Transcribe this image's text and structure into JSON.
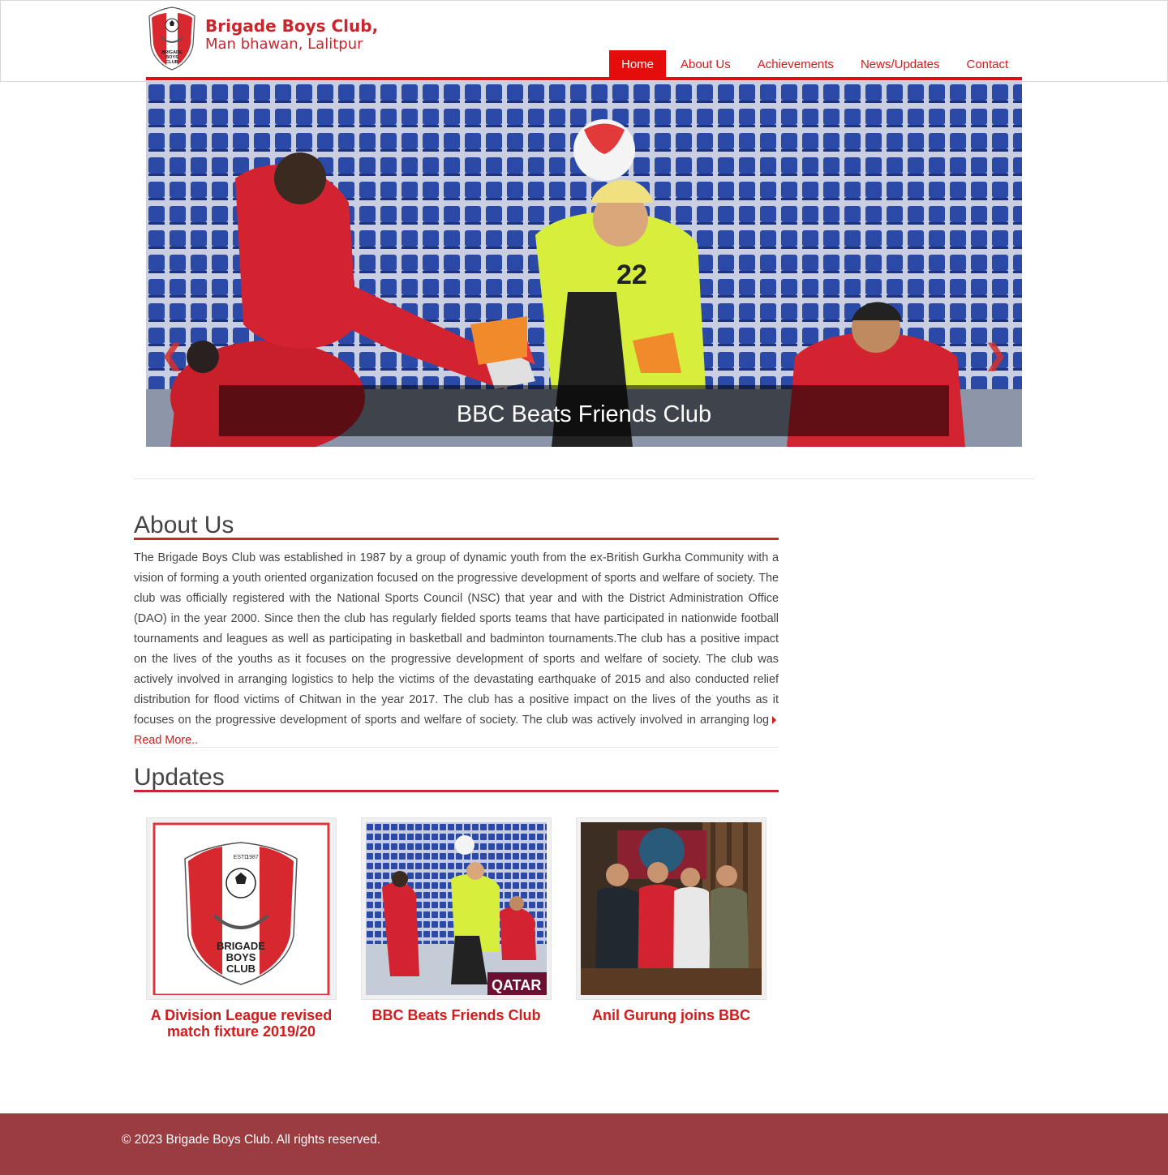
{
  "header": {
    "logo_line1": "Brigade Boys Club,",
    "logo_line2": "Man bhawan, Lalitpur",
    "nav": [
      "Home",
      "About Us",
      "Achievements",
      "News/Updates",
      "Contact"
    ],
    "active_nav": "Home"
  },
  "carousel": {
    "caption": "BBC Beats Friends Club",
    "prev_icon": "chevron-left-icon",
    "next_icon": "chevron-right-icon"
  },
  "about": {
    "heading": "About Us",
    "text": "The Brigade Boys Club was established in 1987 by a group of dynamic youth from the ex-British Gurkha Community with a vision of forming a youth oriented organization focused on the progressive development of sports and welfare of society. The club was officially registered with the National Sports Council (NSC) that year and with the District Administration Office (DAO) in the year 2000. Since then the club has regularly fielded sports teams that have participated in nationwide football tournaments and leagues as well as participating in basketball and badminton tournaments.The club has a positive impact on the lives of the youths as it focuses on the progressive development of sports and welfare of society. The club was actively involved in arranging logistics to help the victims of the devastating earthquake of 2015 and also conducted relief distribution for flood victims of Chitwan in the year 2017. The club has a positive impact on the lives of the youths as it focuses on the progressive development of sports and welfare of society. The club was actively involved in arranging log",
    "read_more": "Read More.."
  },
  "updates": {
    "heading": "Updates",
    "items": [
      {
        "title": "A Division League revised match fixture 2019/20",
        "image": "club-crest"
      },
      {
        "title": "BBC Beats Friends Club",
        "image": "football-match-photo"
      },
      {
        "title": "Anil Gurung joins BBC",
        "image": "group-photo"
      }
    ]
  },
  "logo_badge": {
    "estd": "ESTD",
    "year": "1987",
    "name_line1": "BRIGADE",
    "name_line2": "BOYS",
    "name_line3": "CLUB"
  },
  "colors": {
    "brand_red": "#e50c0c",
    "link_red": "#d01c1c",
    "footer_bg": "#9b3c41"
  },
  "footer": {
    "copyright": "© 2023 Brigade Boys Club. All rights reserved."
  }
}
